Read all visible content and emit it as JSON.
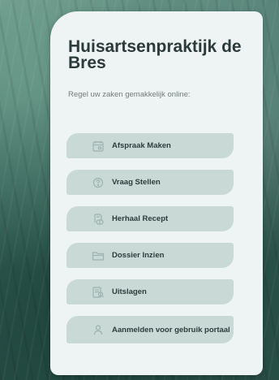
{
  "header": {
    "title": "Huisartsenpraktijk de Bres",
    "subtitle": "Regel uw zaken gemakkelijk online:"
  },
  "menu": {
    "items": [
      {
        "label": "Afspraak Maken",
        "icon": "calendar-icon"
      },
      {
        "label": "Vraag Stellen",
        "icon": "question-icon"
      },
      {
        "label": "Herhaal Recept",
        "icon": "prescription-icon"
      },
      {
        "label": "Dossier Inzien",
        "icon": "folder-icon"
      },
      {
        "label": "Uitslagen",
        "icon": "results-icon"
      },
      {
        "label": "Aanmelden voor gebruik portaal",
        "icon": "user-icon"
      }
    ]
  },
  "colors": {
    "card_background": "#eef3f3",
    "button_background": "#c9d9d6",
    "title_text": "#2a3b3a",
    "icon_stroke": "#9db2ae"
  }
}
